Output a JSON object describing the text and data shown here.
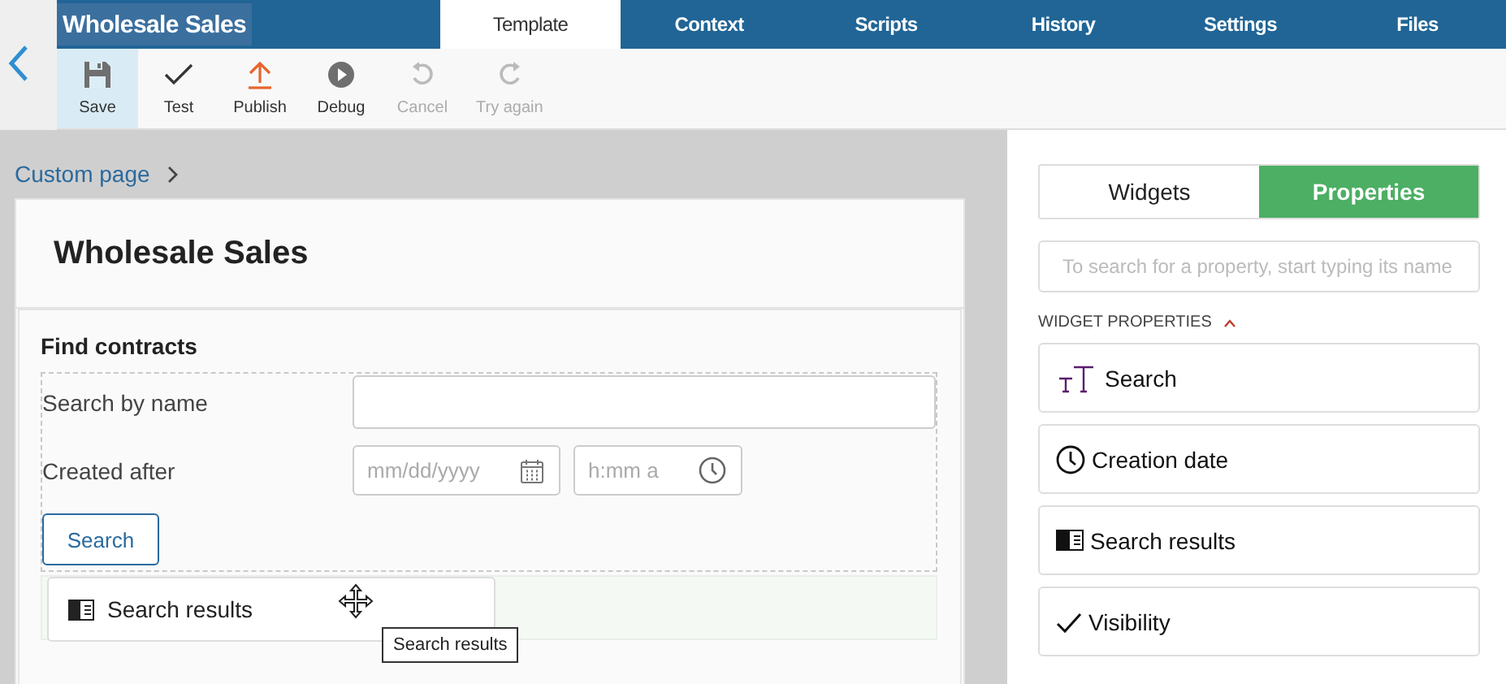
{
  "app_title": "Wholesale Sales",
  "tabs": [
    {
      "label": "Template",
      "selected": true
    },
    {
      "label": "Context",
      "selected": false
    },
    {
      "label": "Scripts",
      "selected": false
    },
    {
      "label": "History",
      "selected": false
    },
    {
      "label": "Settings",
      "selected": false
    },
    {
      "label": "Files",
      "selected": false
    }
  ],
  "toolbar": [
    {
      "kind": "save",
      "label": "Save",
      "selected": true,
      "disabled": false
    },
    {
      "kind": "test",
      "label": "Test",
      "selected": false,
      "disabled": false
    },
    {
      "kind": "publish",
      "label": "Publish",
      "selected": false,
      "disabled": false
    },
    {
      "kind": "debug",
      "label": "Debug",
      "selected": false,
      "disabled": false
    },
    {
      "kind": "undo",
      "label": "Cancel",
      "selected": false,
      "disabled": true
    },
    {
      "kind": "redo",
      "label": "Try again",
      "selected": false,
      "disabled": true
    }
  ],
  "breadcrumb": "Custom page",
  "page": {
    "title": "Wholesale Sales",
    "section_title": "Find contracts",
    "fields": [
      {
        "kind": "text",
        "label": "Search by name"
      },
      {
        "kind": "datetime",
        "label": "Created after",
        "date_placeholder": "mm/dd/yyyy",
        "time_placeholder": "h:mm a"
      }
    ],
    "search_button": "Search",
    "dragged_widget": "Search results",
    "tooltip": "Search results"
  },
  "panel": {
    "tabs": [
      {
        "label": "Widgets",
        "selected": false
      },
      {
        "label": "Properties",
        "selected": true
      }
    ],
    "search": {
      "placeholder": "To search for a property, start typing its name"
    },
    "section": "WIDGET PROPERTIES",
    "expanded": true,
    "items": [
      {
        "kind": "text",
        "label": "Search"
      },
      {
        "kind": "time",
        "label": "Creation date"
      },
      {
        "kind": "results",
        "label": "Search results"
      },
      {
        "kind": "check",
        "label": "Visibility"
      }
    ]
  }
}
